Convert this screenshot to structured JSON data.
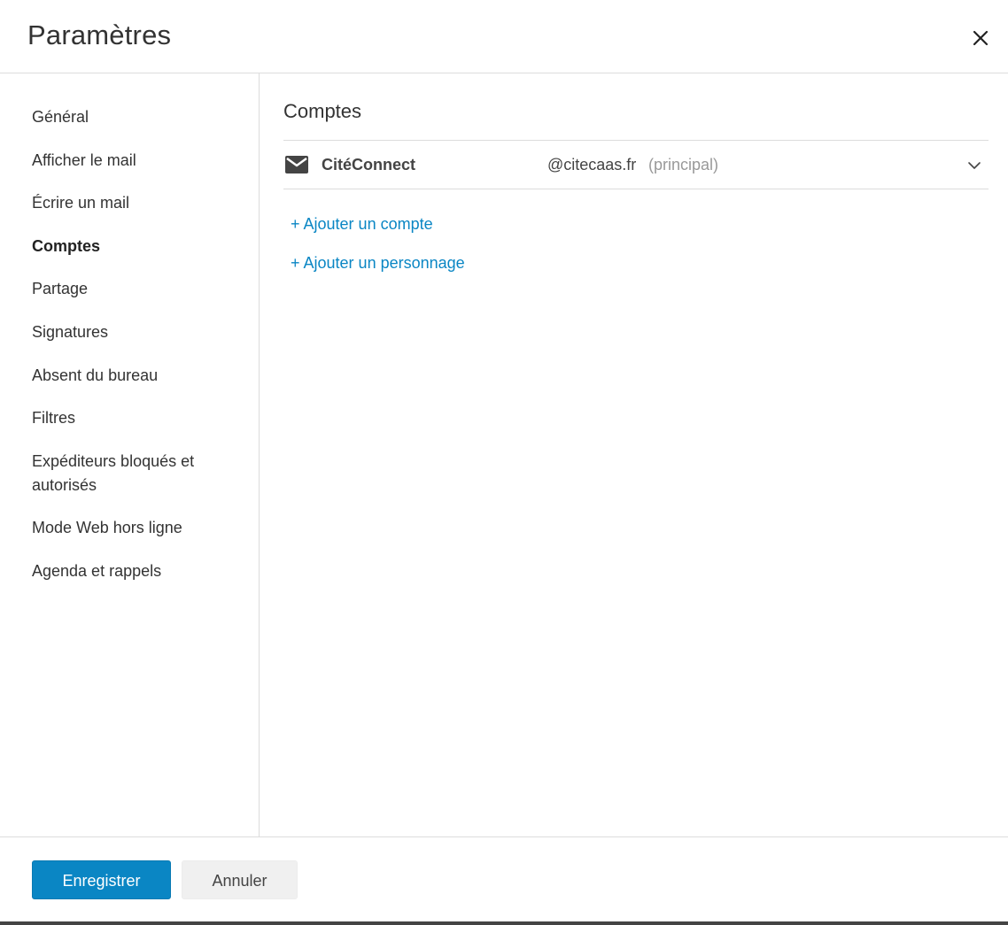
{
  "dialog": {
    "title": "Paramètres",
    "close_icon": "close-icon"
  },
  "sidebar": {
    "items": [
      {
        "label": "Général",
        "active": false
      },
      {
        "label": "Afficher le mail",
        "active": false
      },
      {
        "label": "Écrire un mail",
        "active": false
      },
      {
        "label": "Comptes",
        "active": true
      },
      {
        "label": "Partage",
        "active": false
      },
      {
        "label": "Signatures",
        "active": false
      },
      {
        "label": "Absent du bureau",
        "active": false
      },
      {
        "label": "Filtres",
        "active": false
      },
      {
        "label": "Expéditeurs bloqués et autorisés",
        "active": false
      },
      {
        "label": "Mode Web hors ligne",
        "active": false
      },
      {
        "label": "Agenda et rappels",
        "active": false
      }
    ]
  },
  "main": {
    "section_title": "Comptes",
    "account": {
      "icon": "mail-icon",
      "name": "CitéConnect",
      "email": "@citecaas.fr",
      "tag": "(principal)",
      "expand_icon": "chevron-down-icon"
    },
    "links": {
      "add_account": "+ Ajouter un compte",
      "add_persona": "+ Ajouter un personnage"
    }
  },
  "footer": {
    "save_label": "Enregistrer",
    "cancel_label": "Annuler"
  },
  "colors": {
    "accent": "#0a86c4",
    "text": "#333333",
    "muted": "#999999",
    "divider": "#dcdcdc",
    "secondary_button_bg": "#f0f0f0"
  }
}
